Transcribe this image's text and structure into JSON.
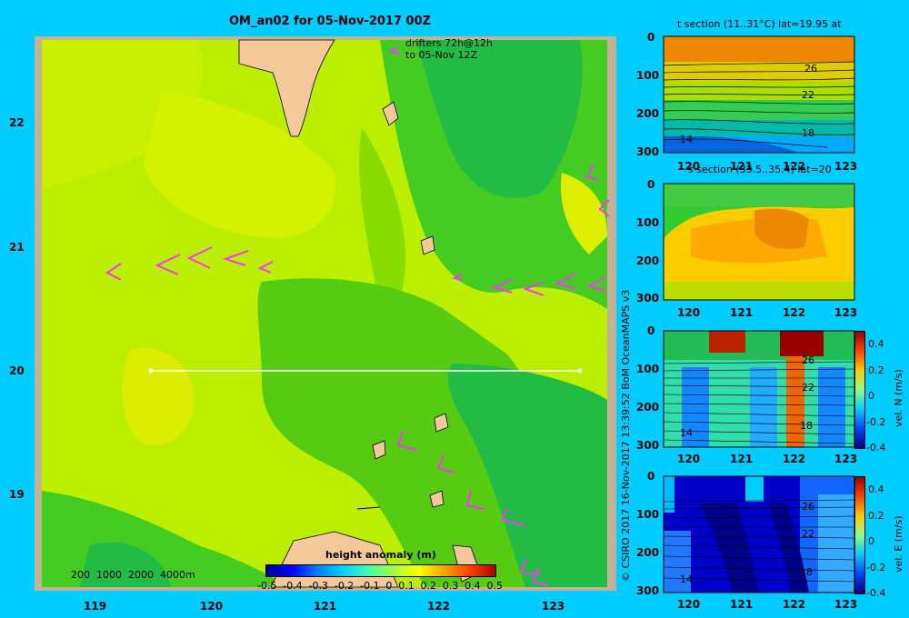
{
  "main_map": {
    "title": "OM_an02 for 05-Nov-2017 00Z",
    "drifters_line1": "drifters 72h@12h",
    "drifters_line2": "to 05-Nov 12Z",
    "lat_ticks": [
      "22",
      "21",
      "20",
      "19"
    ],
    "lon_ticks": [
      "119",
      "120",
      "121",
      "122",
      "123"
    ],
    "depth_legend": [
      "200",
      "1000",
      "2000",
      "4000m"
    ],
    "colorbar_title": "height anomaly  (m)",
    "colorbar_ticks": [
      "-0.5",
      "-0.4",
      "-0.3",
      "-0.2",
      "-0.1",
      "0",
      "0.1",
      "0.2",
      "0.3",
      "0.4",
      "0.5"
    ],
    "section_line": {
      "lat": 20,
      "lon_start": 119.5,
      "lon_end": 123.2
    }
  },
  "panels": [
    {
      "title": "t section (11..31°C) lat=19.95 at",
      "yticks": [
        "0",
        "100",
        "200",
        "300"
      ],
      "xticks": [
        "120",
        "121",
        "122",
        "123"
      ],
      "contour_labels": [
        "26",
        "22",
        "18",
        "14"
      ]
    },
    {
      "title": "s section (33.5..35.4) lat=20",
      "yticks": [
        "0",
        "100",
        "200",
        "300"
      ],
      "xticks": [
        "120",
        "121",
        "122",
        "123"
      ],
      "contour_labels": []
    },
    {
      "title": "",
      "yticks": [
        "0",
        "100",
        "200",
        "300"
      ],
      "xticks": [
        "120",
        "121",
        "122",
        "123"
      ],
      "contour_labels": [
        "26",
        "22",
        "18",
        "14"
      ],
      "colorbar_label": "vel. N (m/s)",
      "colorbar_ticks": [
        "0.4",
        "0.2",
        "0",
        "-0.2",
        "-0.4"
      ]
    },
    {
      "title": "",
      "yticks": [
        "0",
        "100",
        "200",
        "300"
      ],
      "xticks": [
        "120",
        "121",
        "122",
        "123"
      ],
      "contour_labels": [
        "26",
        "22",
        "18",
        "14"
      ],
      "colorbar_label": "vel. E (m/s)",
      "colorbar_ticks": [
        "0.4",
        "0.2",
        "0",
        "-0.2",
        "-0.4"
      ]
    }
  ],
  "credit": "© CSIRO 2017   16-Nov-2017 13:39:52 BoM OceanMAPS v3",
  "colors": {
    "background": "#00ccff",
    "land": "#f5c89a",
    "coast": "#b49882",
    "drifter": "#ff33ff"
  }
}
